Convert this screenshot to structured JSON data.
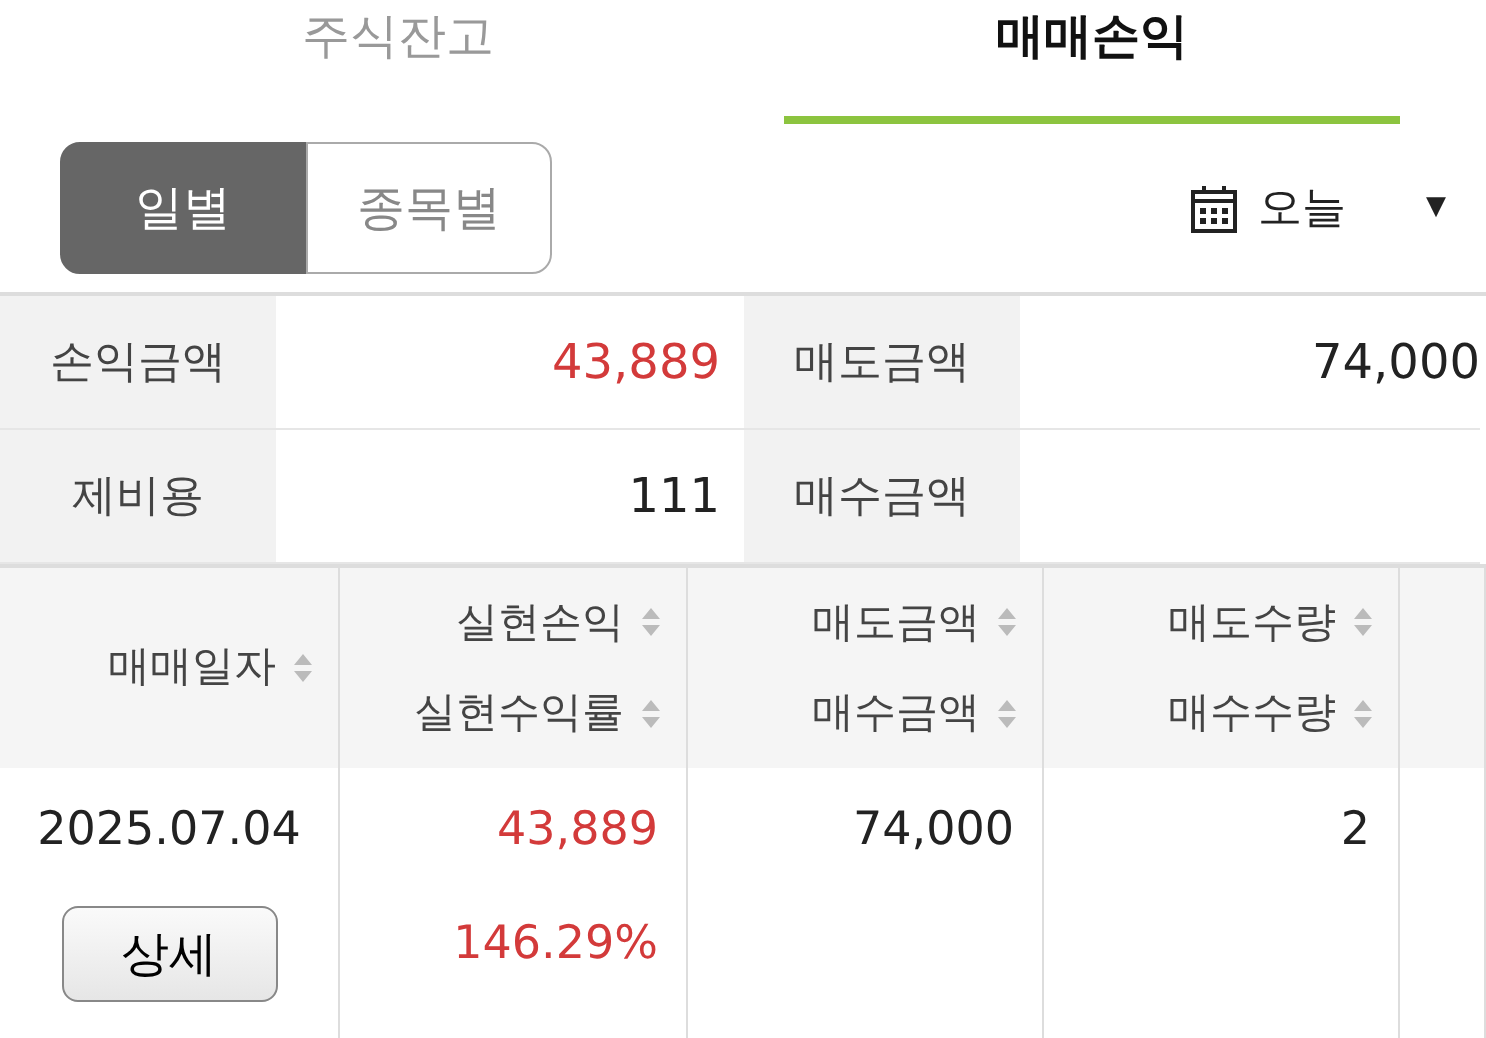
{
  "tabs": [
    {
      "label": "주식잔고",
      "selected": false
    },
    {
      "label": "매매손익",
      "selected": true
    }
  ],
  "period_toggle": [
    {
      "label": "일별",
      "selected": true
    },
    {
      "label": "종목별",
      "selected": false
    }
  ],
  "date_select": {
    "value": "오늘",
    "arrow": "▼"
  },
  "summary": [
    {
      "label": "손익금액",
      "value": "43,889",
      "kind": "profit"
    },
    {
      "label": "매도금액",
      "value": "74,000",
      "kind": "plain"
    },
    {
      "label": "제비용",
      "value": "111",
      "kind": "plain"
    },
    {
      "label": "매수금액",
      "kind": "plain"
    }
  ],
  "table": {
    "columns": [
      {
        "lines": [
          "매매일자"
        ]
      },
      {
        "lines": [
          "실현손익",
          "실현수익률"
        ]
      },
      {
        "lines": [
          "매도금액",
          "매수금액"
        ]
      },
      {
        "lines": [
          "매도수량",
          "매수수량"
        ]
      }
    ],
    "rows": [
      {
        "cells": [
          {
            "lines": [
              "2025.07.04"
            ],
            "button": "상세",
            "kind": "date"
          },
          {
            "lines": [
              "43,889",
              "146.29%"
            ],
            "kind": "profit"
          },
          {
            "lines": [
              "74,000"
            ],
            "kind": "plain"
          },
          {
            "lines": [
              "2"
            ],
            "kind": "plain"
          }
        ]
      }
    ]
  }
}
